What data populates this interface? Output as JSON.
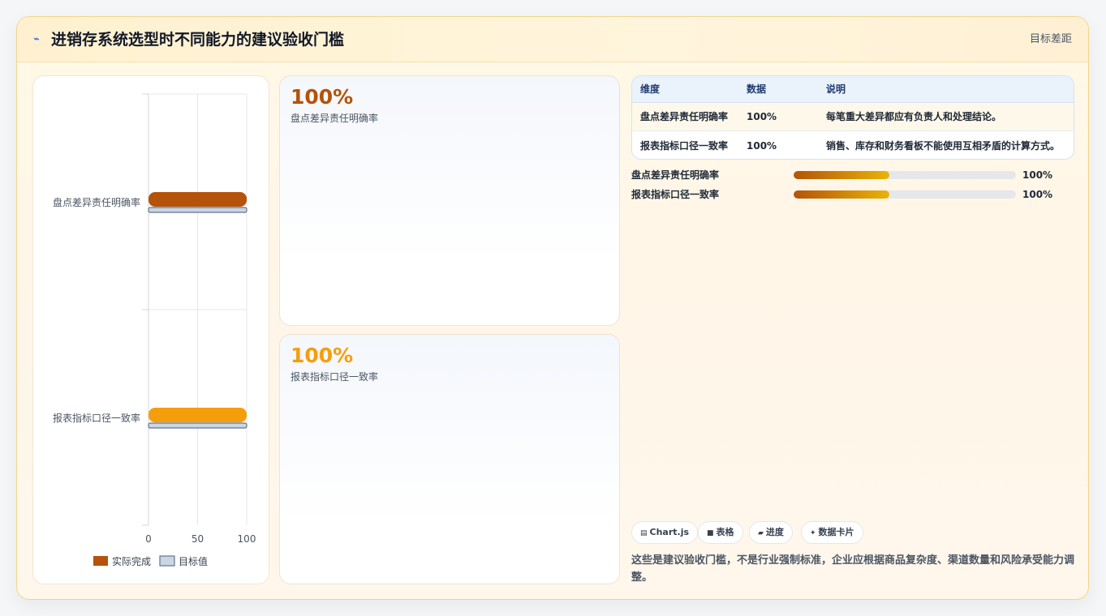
{
  "header": {
    "icon": "chart-line-icon",
    "title": "进销存系统选型时不同能力的建议验收门槛",
    "right_label": "目标差距"
  },
  "chart_data": {
    "type": "bar",
    "orientation": "horizontal",
    "categories": [
      "盘点差异责任明确率",
      "报表指标口径一致率"
    ],
    "series": [
      {
        "name": "实际完成",
        "values": [
          100,
          100
        ],
        "colors": [
          "#b45309",
          "#f59e0b"
        ]
      },
      {
        "name": "目标值",
        "values": [
          100,
          100
        ],
        "color": "#c9d6e6"
      }
    ],
    "xlim": [
      0,
      100
    ],
    "x_ticks": [
      "0",
      "50",
      "100"
    ],
    "legend": "bottom",
    "grid": true
  },
  "cards": [
    {
      "value": "100%",
      "label": "盘点差异责任明确率",
      "color": "#b45309"
    },
    {
      "value": "100%",
      "label": "报表指标口径一致率",
      "color": "#f59e0b"
    }
  ],
  "table": {
    "headers": [
      "维度",
      "数据",
      "说明"
    ],
    "rows": [
      [
        "盘点差异责任明确率",
        "100%",
        "每笔重大差异都应有负责人和处理结论。"
      ],
      [
        "报表指标口径一致率",
        "100%",
        "销售、库存和财务看板不能使用互相矛盾的计算方式。"
      ]
    ]
  },
  "progress": [
    {
      "label": "盘点差异责任明确率",
      "value_text": "100%",
      "fill_fraction": 0.43
    },
    {
      "label": "报表指标口径一致率",
      "value_text": "100%",
      "fill_fraction": 0.43
    }
  ],
  "pills": [
    {
      "icon": "chart-icon",
      "glyph": "▤",
      "label": "Chart.js"
    },
    {
      "icon": "table-icon",
      "glyph": "■",
      "label": "表格"
    },
    {
      "icon": "progress-icon",
      "glyph": "▰",
      "label": "进度"
    },
    {
      "icon": "sparkle-icon",
      "glyph": "✦",
      "label": "数据卡片"
    }
  ],
  "note": "这些是建议验收门槛，不是行业强制标准，企业应根据商品复杂度、渠道数量和风险承受能力调整。"
}
